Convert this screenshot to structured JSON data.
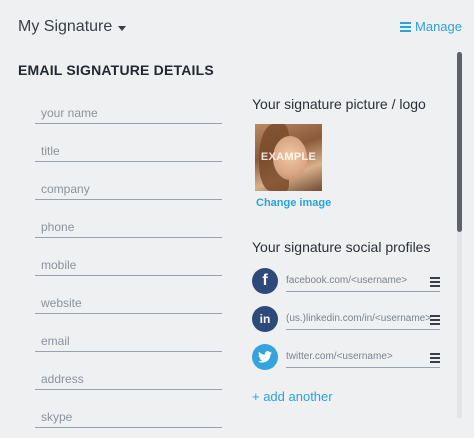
{
  "header": {
    "signature_select": "My Signature",
    "manage_label": "Manage"
  },
  "details": {
    "title": "EMAIL SIGNATURE DETAILS",
    "fields": [
      {
        "placeholder": "your name"
      },
      {
        "placeholder": "title"
      },
      {
        "placeholder": "company"
      },
      {
        "placeholder": "phone"
      },
      {
        "placeholder": "mobile"
      },
      {
        "placeholder": "website"
      },
      {
        "placeholder": "email"
      },
      {
        "placeholder": "address"
      },
      {
        "placeholder": "skype"
      }
    ]
  },
  "picture": {
    "title": "Your signature picture / logo",
    "overlay_text": "EXAMPLE",
    "change_label": "Change image"
  },
  "social": {
    "title": "Your signature social profiles",
    "profiles": [
      {
        "icon": "facebook-icon",
        "glyph": "f",
        "placeholder": "facebook.com/<username>",
        "color": "#2d4a7a"
      },
      {
        "icon": "linkedin-icon",
        "glyph": "in",
        "placeholder": "(us.)linkedin.com/in/<username>",
        "color": "#2d4a7a"
      },
      {
        "icon": "twitter-icon",
        "glyph": "t",
        "placeholder": "twitter.com/<username>",
        "color": "#35a3dd"
      }
    ],
    "add_label": "+ add another"
  },
  "colors": {
    "accent": "#2aa3d9",
    "background": "#eef0f2"
  }
}
